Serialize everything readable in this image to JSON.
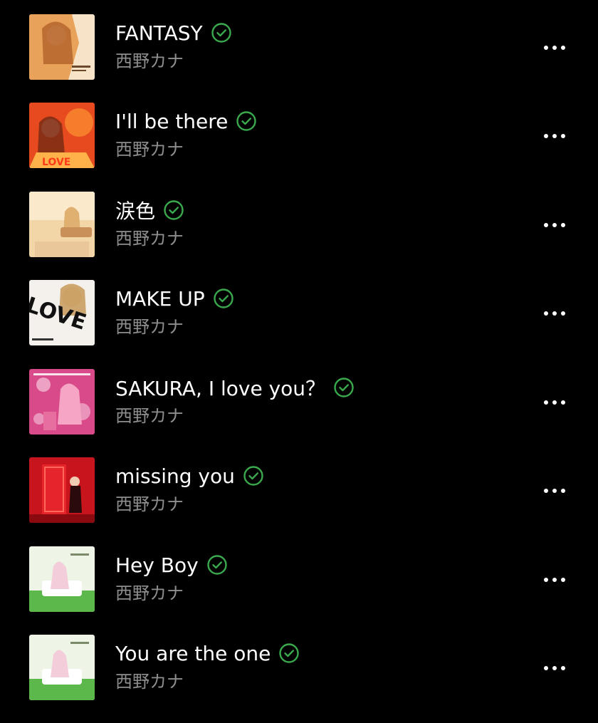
{
  "colors": {
    "background": "#000000",
    "title": "#ffffff",
    "artist": "#8e8e8e",
    "downloaded_check": "#3aa94e"
  },
  "songs": [
    {
      "title": "FANTASY",
      "artist": "西野カナ",
      "status_icon": "downloaded-check-icon",
      "menu_icon": "more-options-icon",
      "cover": {
        "bg": "#e8a25a",
        "accent": "#8a3a1c",
        "theme": "warm portrait"
      }
    },
    {
      "title": "I'll be there",
      "artist": "西野カナ",
      "status_icon": "downloaded-check-icon",
      "menu_icon": "more-options-icon",
      "cover": {
        "bg": "#e64a1e",
        "accent": "#ffb24a",
        "theme": "orange portrait"
      }
    },
    {
      "title": "涙色",
      "artist": "西野カナ",
      "status_icon": "downloaded-check-icon",
      "menu_icon": "more-options-icon",
      "cover": {
        "bg": "#f2d6a8",
        "accent": "#c9905a",
        "theme": "sepia sofa"
      }
    },
    {
      "title": "MAKE UP",
      "artist": "西野カナ",
      "status_icon": "downloaded-check-icon",
      "menu_icon": "more-options-icon",
      "cover": {
        "bg": "#f4f0ec",
        "accent": "#111111",
        "theme": "LOVE letters",
        "text": "LOVE"
      }
    },
    {
      "title": "SAKURA, I love you？",
      "artist": "西野カナ",
      "status_icon": "downloaded-check-icon",
      "menu_icon": "more-options-icon",
      "cover": {
        "bg": "#d84a8a",
        "accent": "#f7c6dc",
        "theme": "pink blossoms"
      }
    },
    {
      "title": "missing you",
      "artist": "西野カナ",
      "status_icon": "downloaded-check-icon",
      "menu_icon": "more-options-icon",
      "cover": {
        "bg": "#c8141c",
        "accent": "#ff5a4a",
        "theme": "red door"
      }
    },
    {
      "title": "Hey Boy",
      "artist": "西野カナ",
      "status_icon": "downloaded-check-icon",
      "menu_icon": "more-options-icon",
      "cover": {
        "bg": "#eef4e6",
        "accent": "#5cb84a",
        "theme": "white sofa on grass"
      }
    },
    {
      "title": "You are the one",
      "artist": "西野カナ",
      "status_icon": "downloaded-check-icon",
      "menu_icon": "more-options-icon",
      "cover": {
        "bg": "#eef4e6",
        "accent": "#5cb84a",
        "theme": "white sofa on grass"
      }
    }
  ]
}
